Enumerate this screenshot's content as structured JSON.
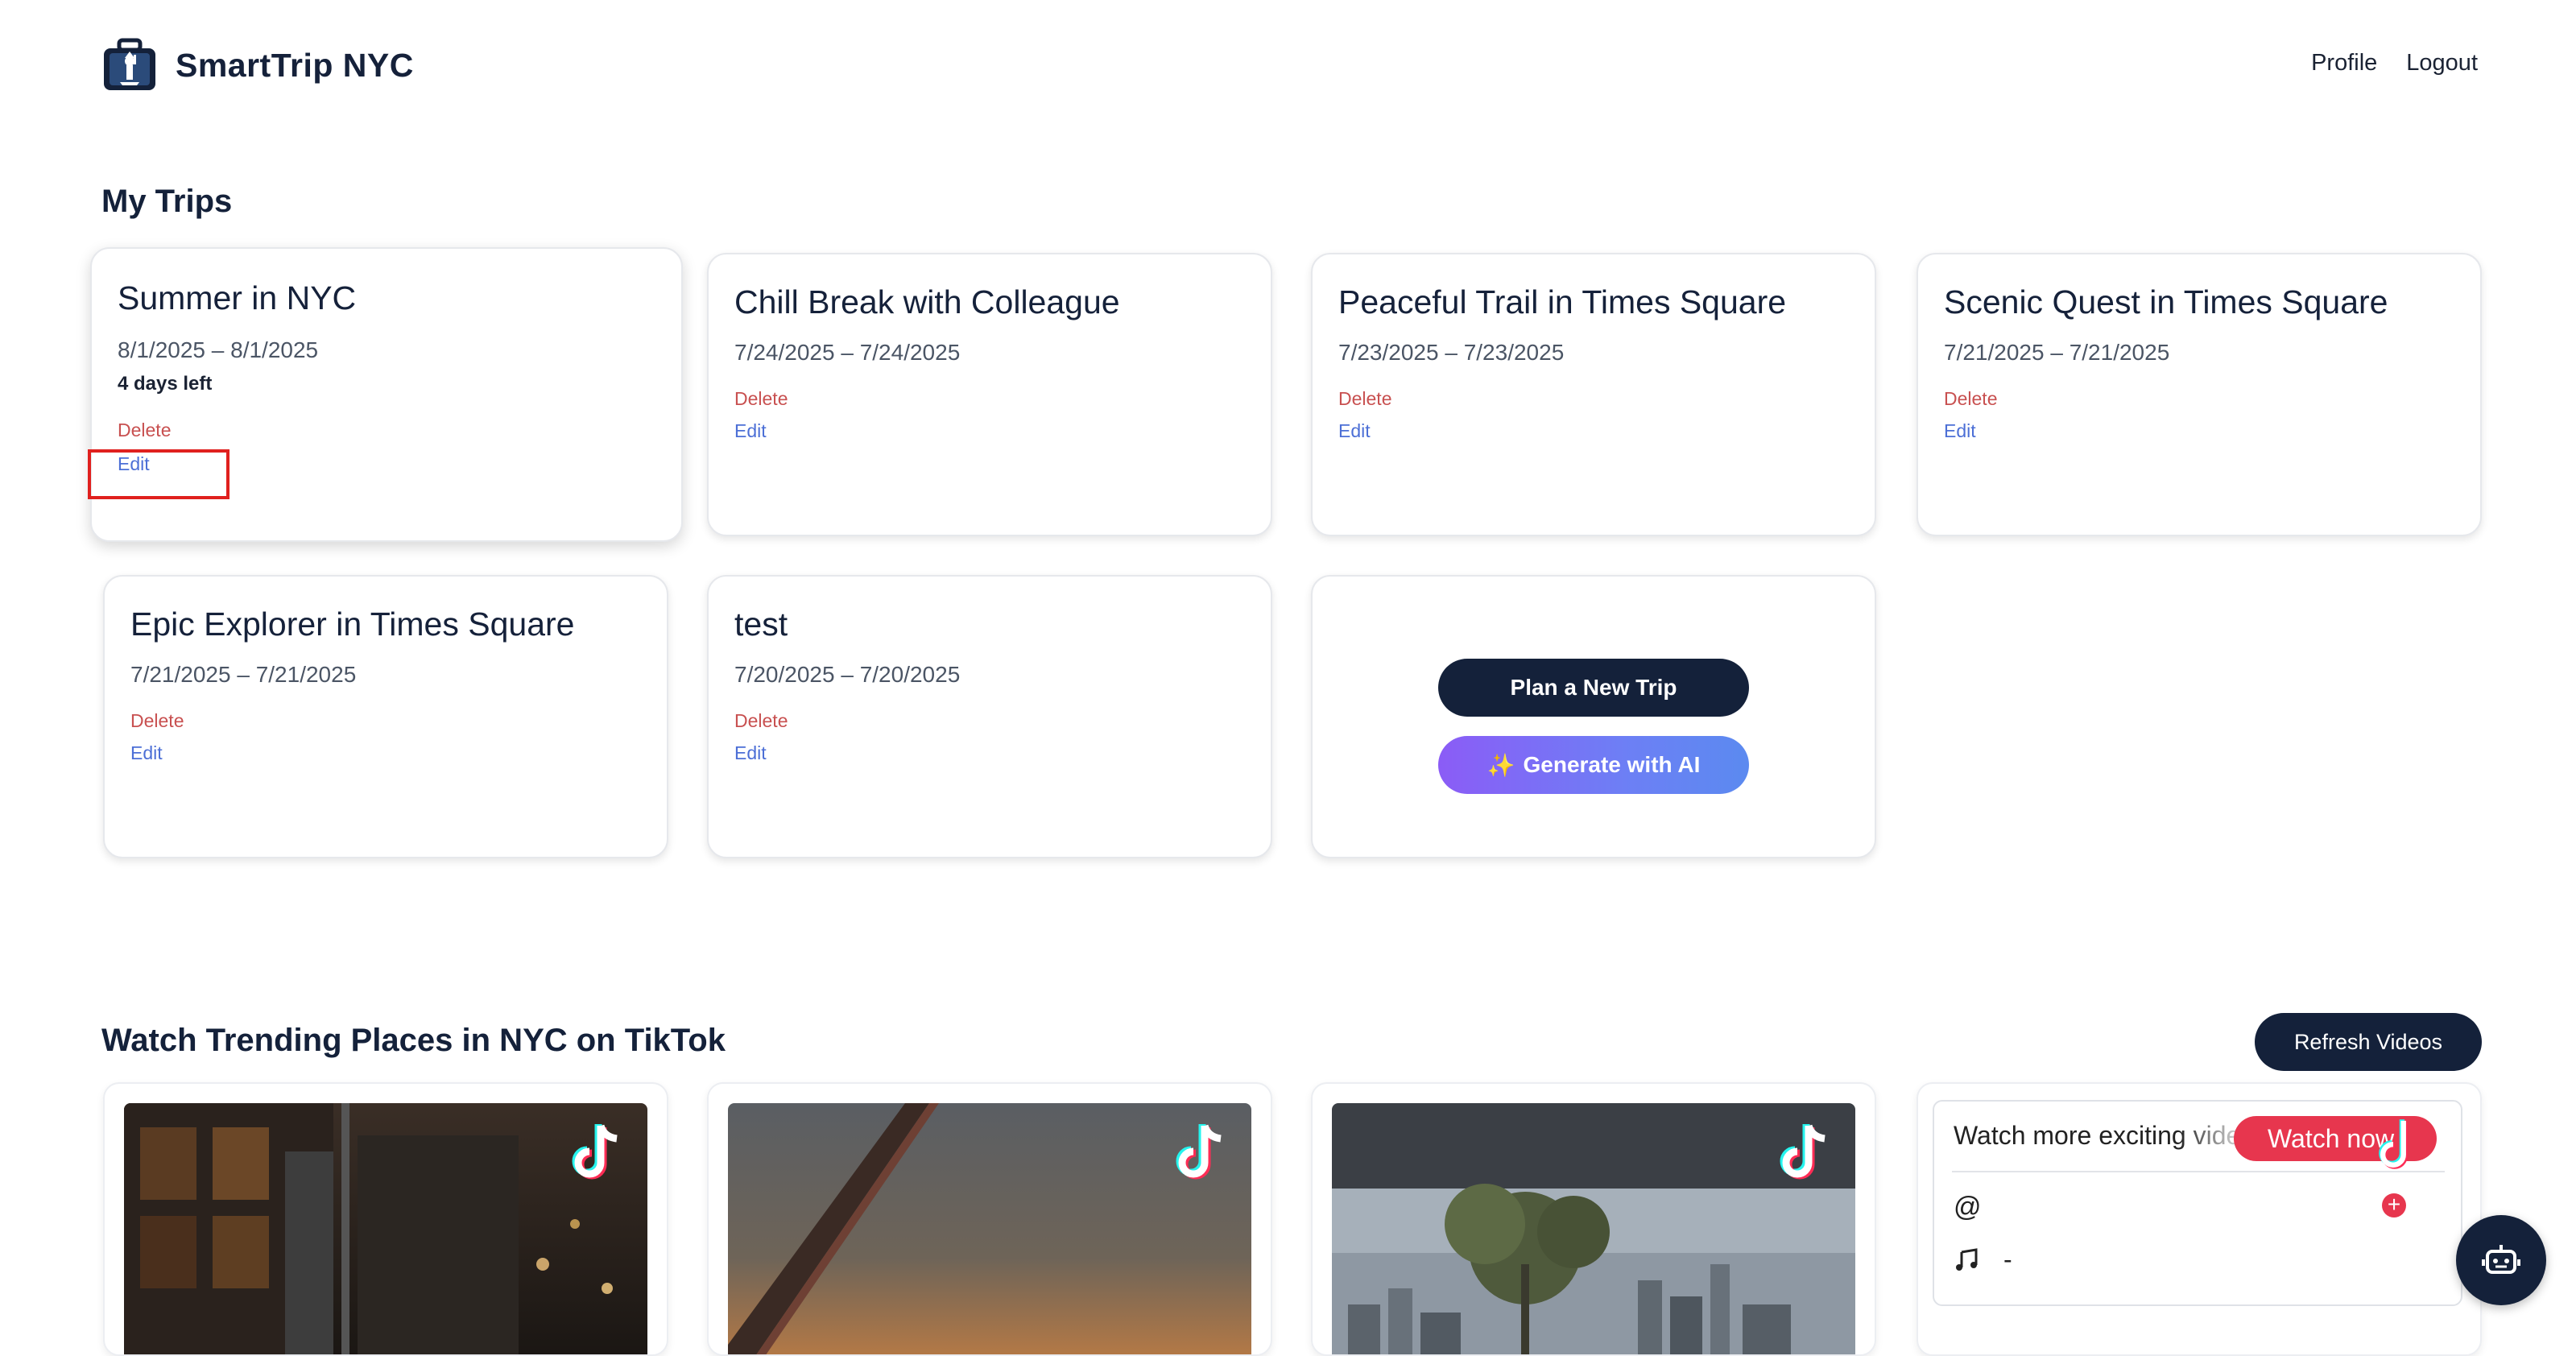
{
  "header": {
    "brand_name": "SmartTrip NYC",
    "nav": {
      "profile": "Profile",
      "logout": "Logout"
    }
  },
  "trips_section": {
    "title": "My Trips",
    "trips": [
      {
        "title": "Summer in NYC",
        "dates": "8/1/2025 – 8/1/2025",
        "days_left": "4 days left",
        "delete": "Delete",
        "edit": "Edit"
      },
      {
        "title": "Chill Break with Colleague",
        "dates": "7/24/2025 – 7/24/2025",
        "delete": "Delete",
        "edit": "Edit"
      },
      {
        "title": "Peaceful Trail in Times Square",
        "dates": "7/23/2025 – 7/23/2025",
        "delete": "Delete",
        "edit": "Edit"
      },
      {
        "title": "Scenic Quest in Times Square",
        "dates": "7/21/2025 – 7/21/2025",
        "delete": "Delete",
        "edit": "Edit"
      },
      {
        "title": "Epic Explorer in Times Square",
        "dates": "7/21/2025 – 7/21/2025",
        "delete": "Delete",
        "edit": "Edit"
      },
      {
        "title": "test",
        "dates": "7/20/2025 – 7/20/2025",
        "delete": "Delete",
        "edit": "Edit"
      }
    ],
    "actions": {
      "plan_new": "Plan a New Trip",
      "generate_ai": "Generate with AI",
      "generate_ai_icon": "✨"
    }
  },
  "tiktok_section": {
    "title": "Watch Trending Places in NYC on TikTok",
    "refresh": "Refresh Videos",
    "embed": {
      "text": "Watch more exciting videos",
      "watch_now": "Watch now",
      "at": "@",
      "music_dash": "-"
    }
  },
  "colors": {
    "primary_dark": "#14213a",
    "delete_red": "#c85050",
    "edit_blue": "#4c6fd6",
    "ai_gradient_start": "#8b5cf6",
    "ai_gradient_end": "#5b8af0",
    "tiktok_red": "#e7364e"
  },
  "icons": {
    "brand": "suitcase-liberty-icon",
    "tiktok": "tiktok-icon",
    "music": "music-note-icon",
    "chat": "robot-icon"
  }
}
